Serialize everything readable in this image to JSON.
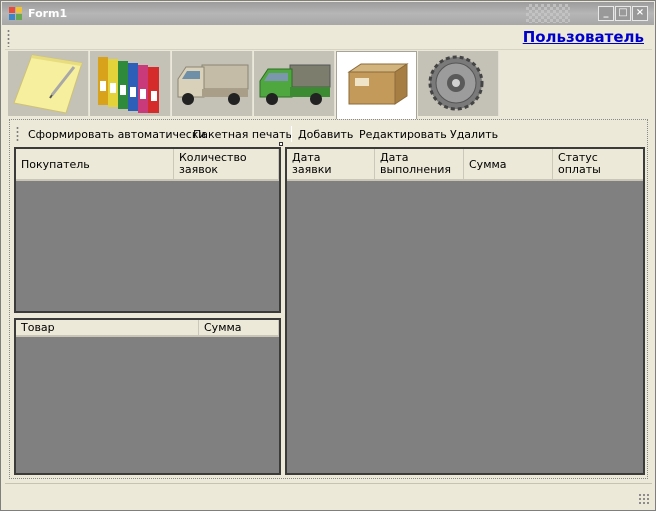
{
  "window": {
    "title": "Form1",
    "minimize": "_",
    "maximize": "□",
    "close": "×"
  },
  "topstrip": {
    "user_link": "Пользователь"
  },
  "tabs": [
    {
      "icon": "notepad-icon"
    },
    {
      "icon": "binders-icon"
    },
    {
      "icon": "truck-icon"
    },
    {
      "icon": "green-truck-icon"
    },
    {
      "icon": "box-icon"
    },
    {
      "icon": "gear-icon"
    }
  ],
  "toolbar": {
    "auto": "Сформировать автоматически",
    "batch_print": "Пакетная печать",
    "add": "Добавить",
    "edit": "Редактировать",
    "delete": "Удалить"
  },
  "buyers_grid": {
    "columns": [
      "Покупатель",
      "Количество\nзаявок"
    ]
  },
  "goods_grid": {
    "columns": [
      "Товар",
      "Сумма"
    ]
  },
  "orders_grid": {
    "columns": [
      "Дата\nзаявки",
      "Дата\nвыполнения",
      "Сумма",
      "Статус\nоплаты"
    ]
  }
}
